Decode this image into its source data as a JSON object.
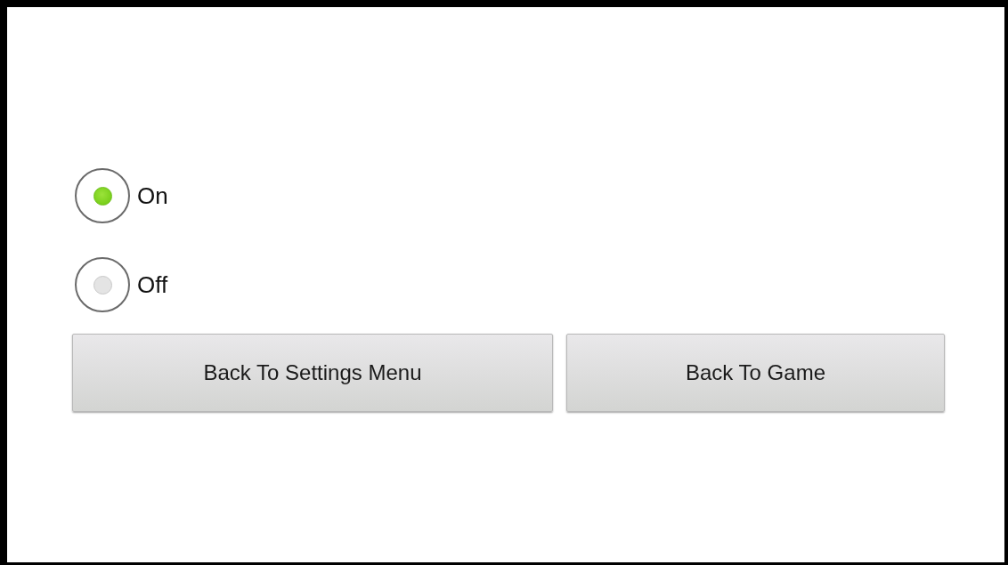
{
  "options": [
    {
      "label": "On",
      "selected": true
    },
    {
      "label": "Off",
      "selected": false
    }
  ],
  "buttons": [
    {
      "label": "Back To Settings Menu"
    },
    {
      "label": "Back To Game"
    }
  ]
}
